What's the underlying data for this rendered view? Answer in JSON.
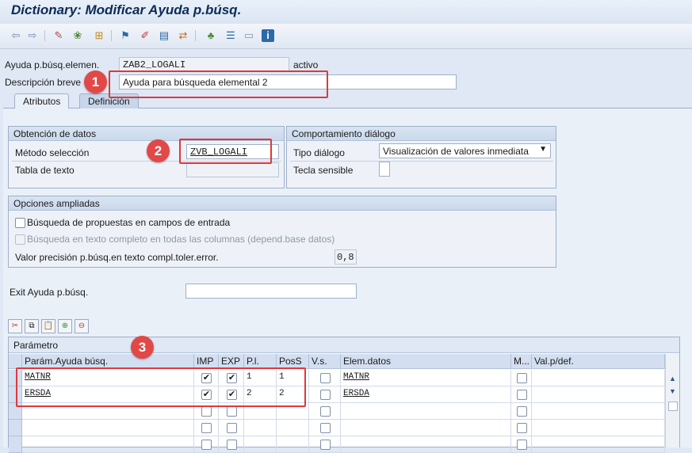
{
  "window": {
    "title": "Dictionary: Modificar Ayuda p.búsq."
  },
  "toolbar": {
    "icons": [
      "back-arrow-icon",
      "forward-arrow-icon",
      "other-object-icon",
      "display-change-icon",
      "activate-icon",
      "check-icon",
      "test-icon",
      "where-used-icon",
      "object-list-icon",
      "navigation-icon",
      "hierarchy-icon",
      "info-icon"
    ]
  },
  "header": {
    "elem_label": "Ayuda p.búsq.elemen.",
    "elem_value": "ZAB2_LOGALI",
    "status": "activo",
    "desc_label": "Descripción breve",
    "desc_value": "Ayuda para búsqueda elemental 2"
  },
  "tabs": [
    {
      "label": "Atributos"
    },
    {
      "label": "Definición"
    }
  ],
  "data_obtain": {
    "title": "Obtención de datos",
    "method_label": "Método selección",
    "method_value": "ZVB_LOGALI",
    "text_table_label": "Tabla de texto",
    "text_table_value": ""
  },
  "dialog": {
    "title": "Comportamiento diálogo",
    "type_label": "Tipo diálogo",
    "type_value": "Visualización de valores inmediata",
    "hotkey_label": "Tecla sensible",
    "hotkey_value": ""
  },
  "extended": {
    "title": "Opciones ampliadas",
    "opt1_label": "Búsqueda de propuestas en campos de entrada",
    "opt2_label": "Búsqueda en texto completo en todas las columnas (depend.base datos)",
    "precision_label": "Valor precisión p.búsq.en texto compl.toler.error.",
    "precision_value": "0,8"
  },
  "exit": {
    "label": "Exit Ayuda p.búsq.",
    "value": ""
  },
  "table": {
    "title": "Parámetro",
    "columns": [
      "Parám.Ayuda búsq.",
      "IMP",
      "EXP",
      "P.l.",
      "PosS",
      "V.s.",
      "Elem.datos",
      "M...",
      "Val.p/def."
    ],
    "rows": [
      {
        "param": "MATNR",
        "imp": true,
        "exp": true,
        "pl": "1",
        "poss": "1",
        "vs": false,
        "elem": "MATNR",
        "m": false,
        "def": ""
      },
      {
        "param": "ERSDA",
        "imp": true,
        "exp": true,
        "pl": "2",
        "poss": "2",
        "vs": false,
        "elem": "ERSDA",
        "m": false,
        "def": ""
      },
      {
        "param": "",
        "imp": false,
        "exp": false,
        "pl": "",
        "poss": "",
        "vs": false,
        "elem": "",
        "m": false,
        "def": ""
      },
      {
        "param": "",
        "imp": false,
        "exp": false,
        "pl": "",
        "poss": "",
        "vs": false,
        "elem": "",
        "m": false,
        "def": ""
      },
      {
        "param": "",
        "imp": false,
        "exp": false,
        "pl": "",
        "poss": "",
        "vs": false,
        "elem": "",
        "m": false,
        "def": ""
      }
    ]
  },
  "annotations": {
    "badge1": "1",
    "badge2": "2",
    "badge3": "3",
    "color": "#e0383b"
  }
}
